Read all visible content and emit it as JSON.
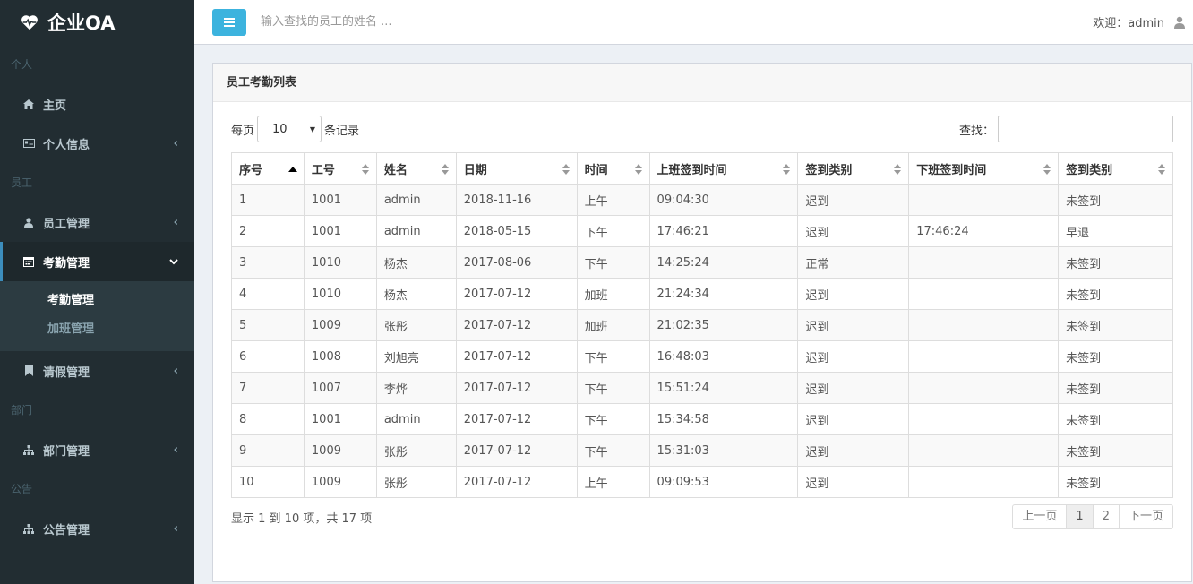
{
  "app": {
    "title": "企业OA"
  },
  "sidebar": {
    "sections": {
      "personal": "个人",
      "staff": "员工",
      "dept": "部门",
      "notice": "公告"
    },
    "items": {
      "home": "主页",
      "profile": "个人信息",
      "staff_mgmt": "员工管理",
      "attendance_mgmt": "考勤管理",
      "leave_mgmt": "请假管理",
      "dept_mgmt": "部门管理",
      "notice_mgmt": "公告管理"
    },
    "submenu": {
      "attendance": "考勤管理",
      "overtime": "加班管理"
    }
  },
  "header": {
    "search_placeholder": "输入查找的员工的姓名 ...",
    "welcome": "欢迎：admin"
  },
  "box": {
    "title": "员工考勤列表",
    "length_prefix": "每页",
    "length_value": "10",
    "length_suffix": "条记录",
    "filter_label": "查找："
  },
  "table": {
    "headers": [
      "序号",
      "工号",
      "姓名",
      "日期",
      "时间",
      "上班签到时间",
      "签到类别",
      "下班签到时间",
      "签到类别"
    ],
    "rows": [
      [
        "1",
        "1001",
        "admin",
        "2018-11-16",
        "上午",
        "09:04:30",
        "迟到",
        "",
        "未签到"
      ],
      [
        "2",
        "1001",
        "admin",
        "2018-05-15",
        "下午",
        "17:46:21",
        "迟到",
        "17:46:24",
        "早退"
      ],
      [
        "3",
        "1010",
        "杨杰",
        "2017-08-06",
        "下午",
        "14:25:24",
        "正常",
        "",
        "未签到"
      ],
      [
        "4",
        "1010",
        "杨杰",
        "2017-07-12",
        "加班",
        "21:24:34",
        "迟到",
        "",
        "未签到"
      ],
      [
        "5",
        "1009",
        "张彤",
        "2017-07-12",
        "加班",
        "21:02:35",
        "迟到",
        "",
        "未签到"
      ],
      [
        "6",
        "1008",
        "刘旭亮",
        "2017-07-12",
        "下午",
        "16:48:03",
        "迟到",
        "",
        "未签到"
      ],
      [
        "7",
        "1007",
        "李烨",
        "2017-07-12",
        "下午",
        "15:51:24",
        "迟到",
        "",
        "未签到"
      ],
      [
        "8",
        "1001",
        "admin",
        "2017-07-12",
        "下午",
        "15:34:58",
        "迟到",
        "",
        "未签到"
      ],
      [
        "9",
        "1009",
        "张彤",
        "2017-07-12",
        "下午",
        "15:31:03",
        "迟到",
        "",
        "未签到"
      ],
      [
        "10",
        "1009",
        "张彤",
        "2017-07-12",
        "上午",
        "09:09:53",
        "迟到",
        "",
        "未签到"
      ]
    ]
  },
  "footer": {
    "info": "显示 1 到 10 项，共 17 项",
    "prev": "上一页",
    "pages": [
      "1",
      "2"
    ],
    "next": "下一页"
  },
  "colors": {
    "sidebar_bg": "#222d32",
    "accent": "#3cb3de",
    "active_border": "#3c8dbc"
  }
}
